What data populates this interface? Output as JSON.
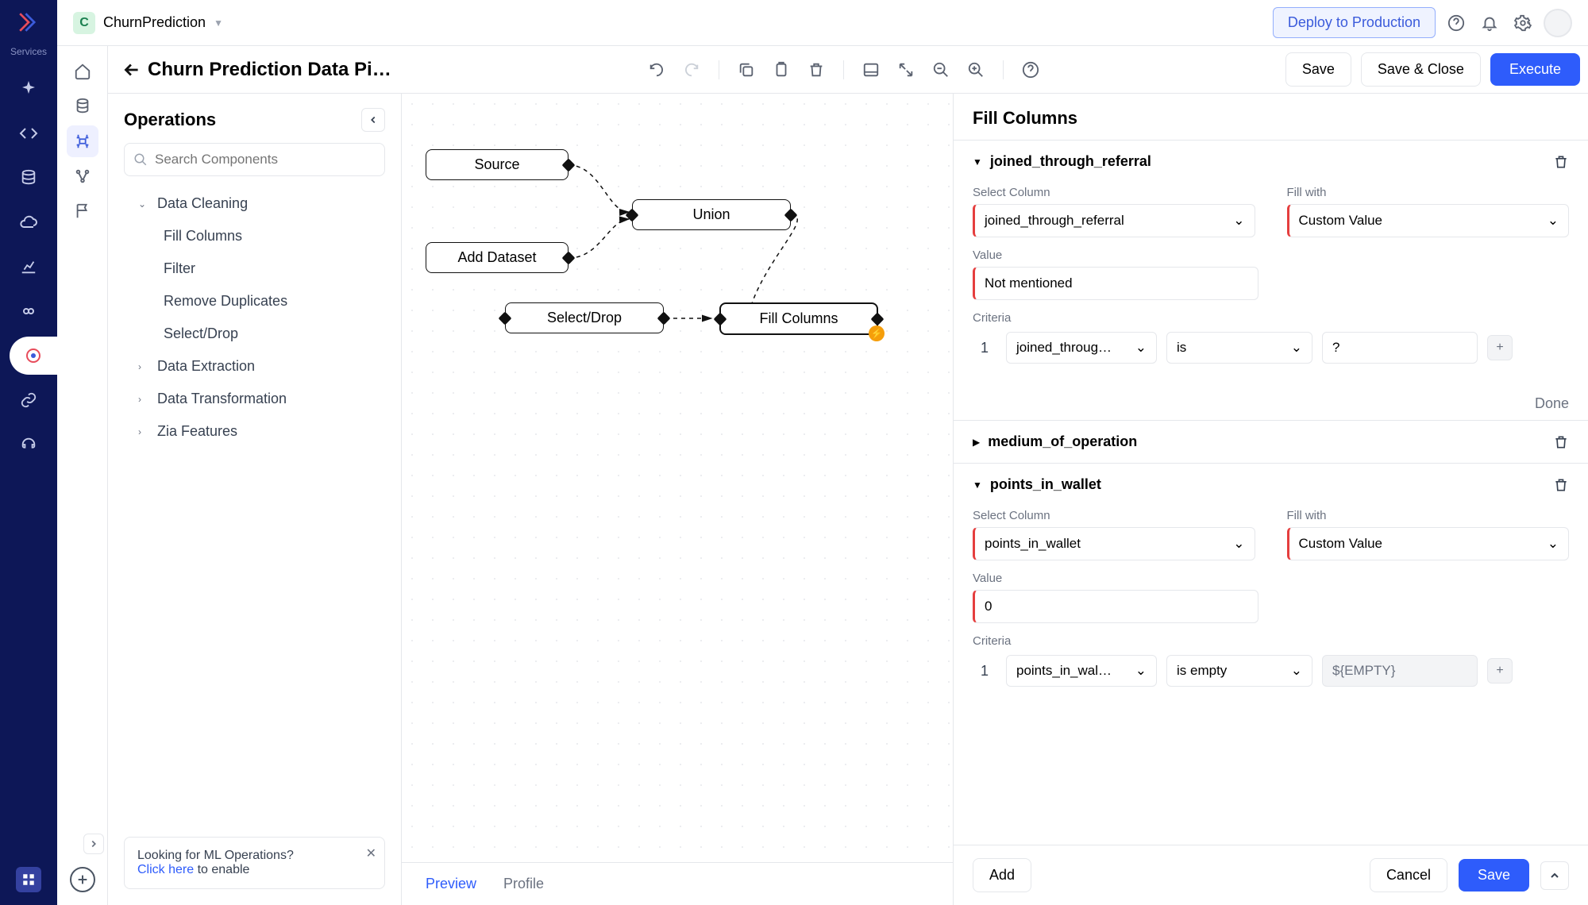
{
  "header": {
    "project_initial": "C",
    "project_name": "ChurnPrediction",
    "deploy_label": "Deploy to Production"
  },
  "nav_rail": {
    "services_label": "Services"
  },
  "toolbar": {
    "title": "Churn Prediction Data Pipe…",
    "save": "Save",
    "save_close": "Save & Close",
    "execute": "Execute"
  },
  "ops": {
    "title": "Operations",
    "search_placeholder": "Search Components",
    "tree": {
      "data_cleaning": "Data Cleaning",
      "leaves": [
        "Fill Columns",
        "Filter",
        "Remove Duplicates",
        "Select/Drop"
      ],
      "data_extraction": "Data Extraction",
      "data_transformation": "Data Transformation",
      "zia_features": "Zia Features"
    },
    "hint_line1": "Looking for ML Operations?",
    "hint_link": "Click here",
    "hint_rest": " to enable"
  },
  "canvas": {
    "nodes": {
      "source": "Source",
      "add_dataset": "Add Dataset",
      "union": "Union",
      "select_drop": "Select/Drop",
      "fill_columns": "Fill Columns"
    },
    "tabs": {
      "preview": "Preview",
      "profile": "Profile"
    }
  },
  "panel": {
    "title": "Fill Columns",
    "sections": [
      {
        "name": "joined_through_referral",
        "expanded": true,
        "select_column_label": "Select Column",
        "select_column_value": "joined_through_referral",
        "fill_with_label": "Fill with",
        "fill_with_value": "Custom Value",
        "value_label": "Value",
        "value": "Not mentioned",
        "criteria_label": "Criteria",
        "criteria": {
          "idx": "1",
          "col": "joined_throug…",
          "op": "is",
          "val": "?"
        },
        "done": "Done"
      },
      {
        "name": "medium_of_operation",
        "expanded": false
      },
      {
        "name": "points_in_wallet",
        "expanded": true,
        "select_column_label": "Select Column",
        "select_column_value": "points_in_wallet",
        "fill_with_label": "Fill with",
        "fill_with_value": "Custom Value",
        "value_label": "Value",
        "value": "0",
        "criteria_label": "Criteria",
        "criteria": {
          "idx": "1",
          "col": "points_in_wal…",
          "op": "is empty",
          "val_placeholder": "${EMPTY}"
        }
      }
    ],
    "footer": {
      "add": "Add",
      "cancel": "Cancel",
      "save": "Save"
    }
  }
}
